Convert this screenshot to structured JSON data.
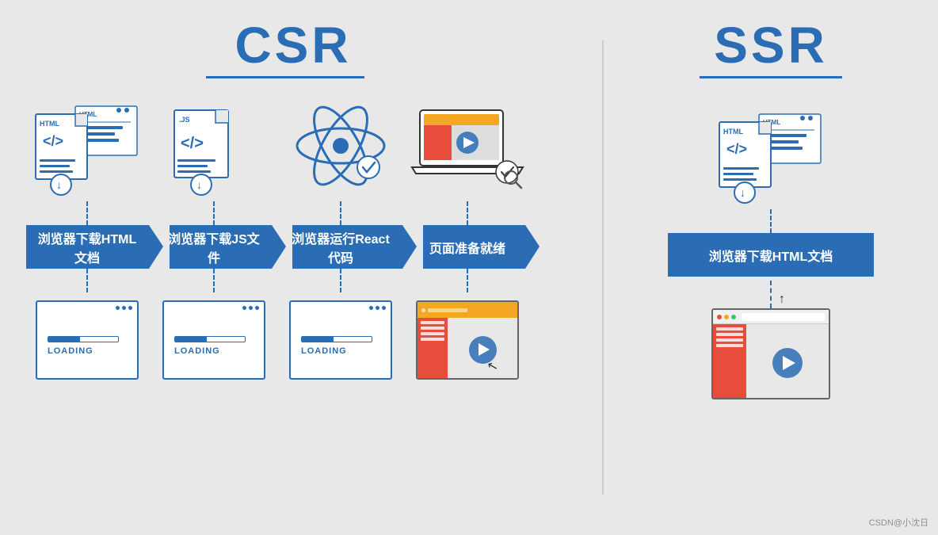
{
  "csr": {
    "title": "CSR",
    "steps": [
      {
        "label": "浏览器下载HTML文档",
        "icon": "html-file",
        "bottom": "loading"
      },
      {
        "label": "浏览器下载JS文件",
        "icon": "js-file",
        "bottom": "loading"
      },
      {
        "label": "浏览器运行React代码",
        "icon": "react",
        "bottom": "loading"
      },
      {
        "label": "页面准备就绪",
        "icon": "laptop",
        "bottom": "page-ready"
      }
    ],
    "loading_text": "LOADING"
  },
  "ssr": {
    "title": "SSR",
    "steps": [
      {
        "label": "浏览器下载HTML文档",
        "icon": "html-file",
        "bottom": "page-ready"
      }
    ]
  },
  "watermark": "CSDN@小沈日"
}
